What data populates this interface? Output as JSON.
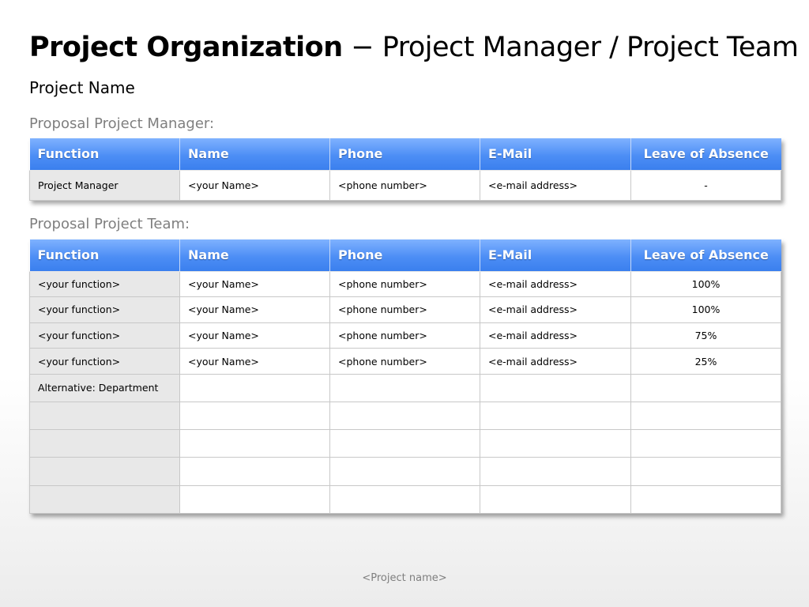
{
  "title": {
    "bold": "Project Organization",
    "rest": " − Project Manager / Project Team"
  },
  "subtitle": "Project Name",
  "manager_section": {
    "label": "Proposal Project Manager:",
    "headers": [
      "Function",
      "Name",
      "Phone",
      "E-Mail",
      "Leave of Absence"
    ],
    "rows": [
      [
        "Project Manager",
        "<your Name>",
        "<phone number>",
        "<e-mail address>",
        "-"
      ]
    ]
  },
  "team_section": {
    "label": "Proposal Project Team:",
    "headers": [
      "Function",
      "Name",
      "Phone",
      "E-Mail",
      "Leave of Absence"
    ],
    "rows": [
      [
        "<your function>",
        "<your Name>",
        "<phone number>",
        "<e-mail address>",
        "100%"
      ],
      [
        "<your function>",
        "<your Name>",
        "<phone number>",
        "<e-mail address>",
        "100%"
      ],
      [
        "<your function>",
        "<your Name>",
        "<phone number>",
        "<e-mail address>",
        "75%"
      ],
      [
        "<your function>",
        "<your Name>",
        "<phone number>",
        "<e-mail address>",
        "25%"
      ],
      [
        "Alternative: Department",
        "",
        "",
        "",
        ""
      ],
      [
        "",
        "",
        "",
        "",
        ""
      ],
      [
        "",
        "",
        "",
        "",
        ""
      ],
      [
        "",
        "",
        "",
        "",
        ""
      ],
      [
        "",
        "",
        "",
        "",
        ""
      ]
    ]
  },
  "footer": "<Project name>",
  "colors": {
    "header_blue": "#4d8ef5",
    "function_cell_gray": "#e8e8e8",
    "label_gray": "#7f7f7f"
  }
}
